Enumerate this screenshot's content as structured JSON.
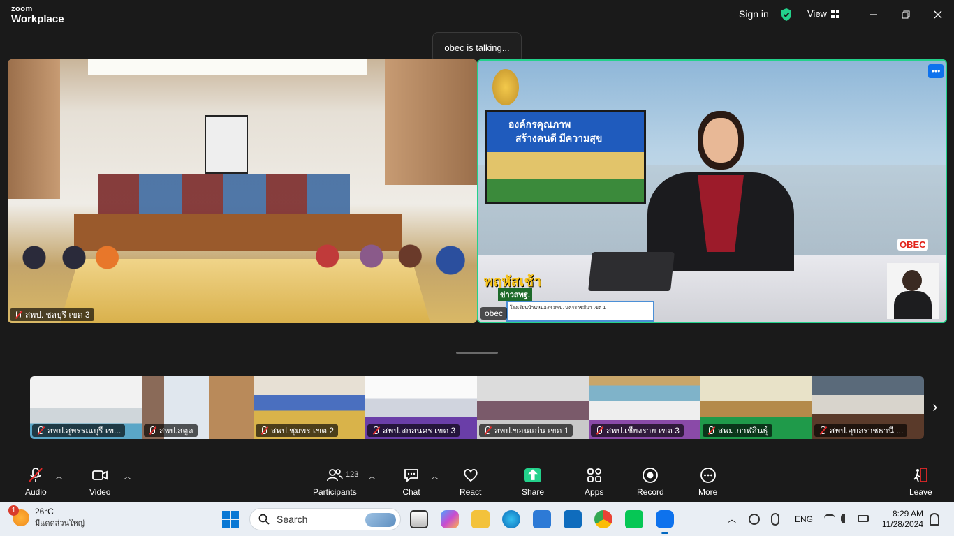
{
  "app": {
    "brand_top": "zoom",
    "brand_bottom": "Workplace",
    "sign_in": "Sign in",
    "view_label": "View"
  },
  "main": {
    "talking_indicator": "obec is talking...",
    "left_tile_name": "สพป. ชลบุรี เขต 3",
    "right_tile_name": "obec",
    "slide_title_1": "องค์กรคุณภาพ",
    "slide_title_2": "สร้างคนดี มีความสุข",
    "show_name": "พฤหัสเช้า",
    "show_sub": "ข่าวสพฐ.",
    "corner_logo": "OBEC",
    "ticker": "โรงเรียนบ้านหนองฯ สพป. นครราชสีมา เขต 1"
  },
  "thumbnails": [
    {
      "name": "สพป.สุพรรณบุรี เข..."
    },
    {
      "name": "สพป.สตูล"
    },
    {
      "name": "สพป.ชุมพร เขต 2"
    },
    {
      "name": "สพป.สกลนคร เขต 3"
    },
    {
      "name": "สพป.ขอนแก่น เขต 1"
    },
    {
      "name": "สพป.เชียงราย เขต 3"
    },
    {
      "name": "สพม.กาฬสินธุ์"
    },
    {
      "name": "สพป.อุบลราชธานี ..."
    }
  ],
  "toolbar": {
    "audio": "Audio",
    "video": "Video",
    "participants": "Participants",
    "participants_count": "123",
    "chat": "Chat",
    "react": "React",
    "share": "Share",
    "apps": "Apps",
    "record": "Record",
    "more": "More",
    "leave": "Leave"
  },
  "taskbar": {
    "weather_badge": "1",
    "temperature": "26°C",
    "weather_desc": "มีแดดส่วนใหญ่",
    "search_placeholder": "Search",
    "lang": "ENG",
    "time": "8:29 AM",
    "date": "11/28/2024"
  },
  "colors": {
    "active_speaker_border": "#23d18b",
    "accent_blue": "#0e72ed",
    "mute_red": "#e02828"
  }
}
